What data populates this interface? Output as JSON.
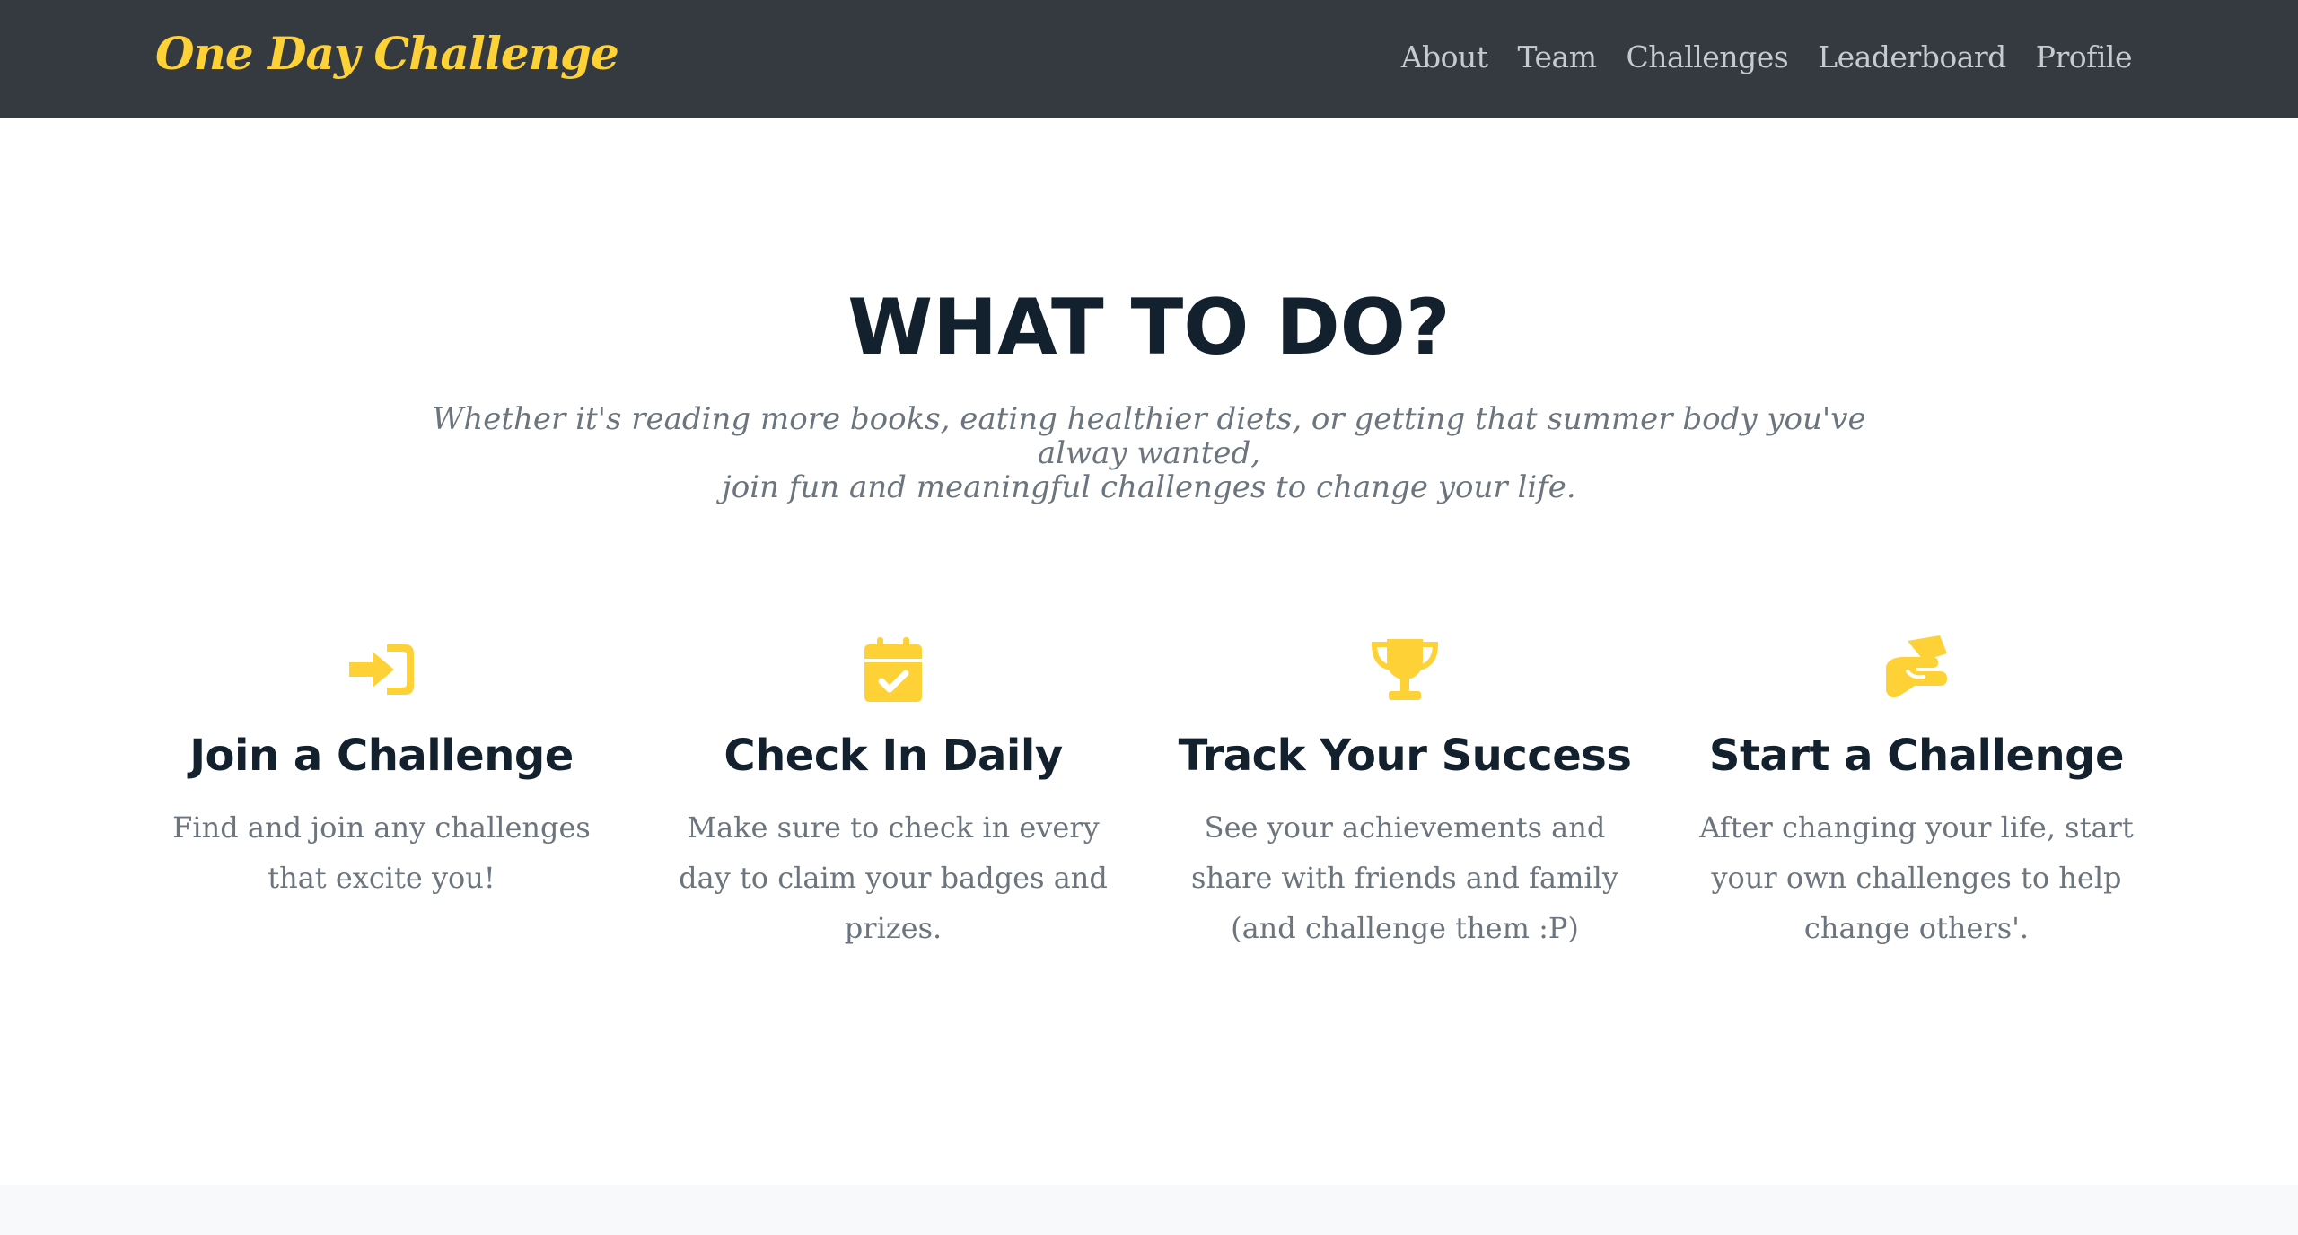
{
  "navbar": {
    "brand": "One Day Challenge",
    "links": [
      "About",
      "Team",
      "Challenges",
      "Leaderboard",
      "Profile"
    ]
  },
  "section": {
    "title": "WHAT TO DO?",
    "subtitle_line1": "Whether it's reading more books, eating healthier diets, or getting that summer body you've alway wanted,",
    "subtitle_line2": "join fun and meaningful challenges to change your life."
  },
  "features": [
    {
      "icon": "sign-in-icon",
      "title": "Join a Challenge",
      "text": "Find and join any challenges that excite you!"
    },
    {
      "icon": "calendar-check-icon",
      "title": "Check In Daily",
      "text": "Make sure to check in every day to claim your badges and prizes."
    },
    {
      "icon": "trophy-icon",
      "title": "Track Your Success",
      "text": "See your achievements and share with friends and family (and challenge them :P)"
    },
    {
      "icon": "handshake-icon",
      "title": "Start a Challenge",
      "text": "After changing your life, start your own challenges to help change others'."
    }
  ],
  "colors": {
    "accent": "#fed136",
    "navbar_bg": "#343a40",
    "heading": "#13202e",
    "muted": "#6c757d"
  }
}
